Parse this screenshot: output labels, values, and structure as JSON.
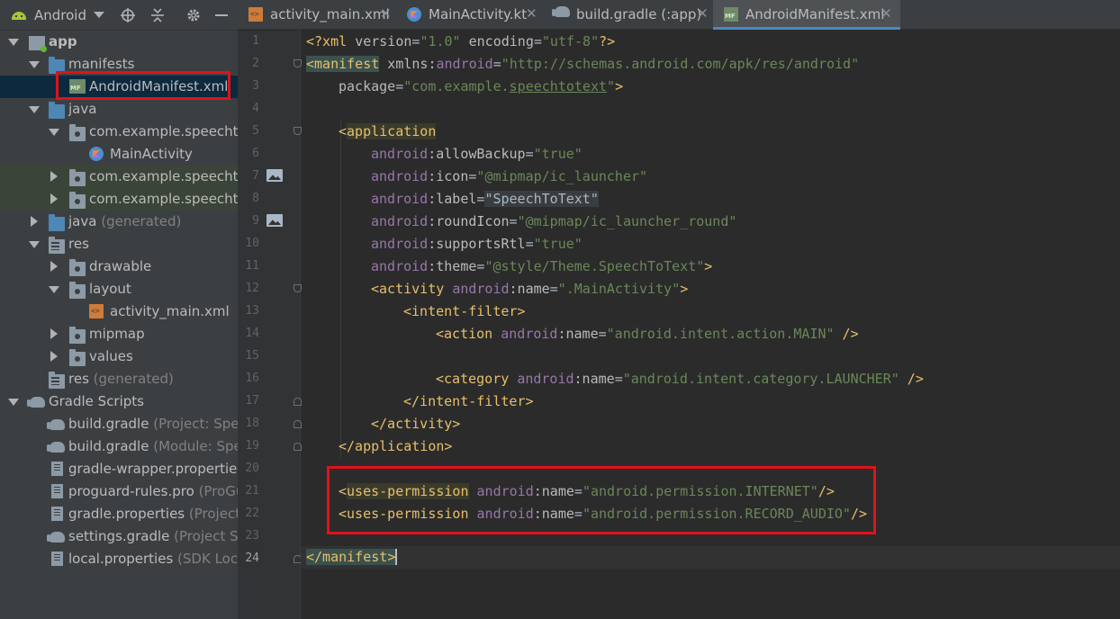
{
  "sidebar": {
    "view_label": "Android",
    "tree": [
      {
        "label": "app",
        "sub": "",
        "bold": true
      },
      {
        "label": "manifests",
        "sub": ""
      },
      {
        "label": "AndroidManifest.xml",
        "sub": ""
      },
      {
        "label": "java",
        "sub": ""
      },
      {
        "label": "com.example.speechtote",
        "sub": ""
      },
      {
        "label": "MainActivity",
        "sub": ""
      },
      {
        "label": "com.example.speechtote",
        "sub": ""
      },
      {
        "label": "com.example.speechtote",
        "sub": ""
      },
      {
        "label": "java",
        "sub": "(generated)"
      },
      {
        "label": "res",
        "sub": ""
      },
      {
        "label": "drawable",
        "sub": ""
      },
      {
        "label": "layout",
        "sub": ""
      },
      {
        "label": "activity_main.xml",
        "sub": ""
      },
      {
        "label": "mipmap",
        "sub": ""
      },
      {
        "label": "values",
        "sub": ""
      },
      {
        "label": "res",
        "sub": "(generated)"
      },
      {
        "label": "Gradle Scripts",
        "sub": ""
      },
      {
        "label": "build.gradle",
        "sub": "(Project: Speec"
      },
      {
        "label": "build.gradle",
        "sub": "(Module: Speec"
      },
      {
        "label": "gradle-wrapper.properties",
        "sub": "("
      },
      {
        "label": "proguard-rules.pro",
        "sub": "(ProGua"
      },
      {
        "label": "gradle.properties",
        "sub": "(Project P"
      },
      {
        "label": "settings.gradle",
        "sub": "(Project Sett"
      },
      {
        "label": "local.properties",
        "sub": "(SDK Locati"
      }
    ]
  },
  "tabs": [
    {
      "name": "activity_main.xml",
      "close": "✕"
    },
    {
      "name": "MainActivity.kt",
      "close": "✕"
    },
    {
      "name": "build.gradle (:app)",
      "close": "✕"
    },
    {
      "name": "AndroidManifest.xml",
      "close": "✕"
    }
  ],
  "editor": {
    "line_numbers": [
      "1",
      "2",
      "3",
      "4",
      "5",
      "6",
      "7",
      "8",
      "9",
      "10",
      "11",
      "12",
      "13",
      "14",
      "15",
      "16",
      "17",
      "18",
      "19",
      "20",
      "21",
      "22",
      "23",
      "24"
    ],
    "code": {
      "l1": {
        "a": "<?xml ",
        "b": "version",
        "c": "=",
        "d": "\"1.0\"",
        "e": " ",
        "f": "encoding",
        "g": "=",
        "h": "\"utf-8\"",
        "i": "?>"
      },
      "l2": {
        "a": "<",
        "b": "manifest",
        "c": " xmlns:",
        "d": "android",
        "e": "=",
        "f": "\"http://schemas.android.com/apk/res/android\""
      },
      "l3": {
        "a": "package",
        "b": "=",
        "c": "\"com.example.",
        "d": "speechtotext",
        "e": "\"",
        "f": ">"
      },
      "l5": {
        "a": "<",
        "b": "application"
      },
      "l6": {
        "ns": "android",
        "attr": ":allowBackup",
        "eq": "=",
        "val": "\"true\""
      },
      "l7": {
        "ns": "android",
        "attr": ":icon",
        "eq": "=",
        "val": "\"@mipmap/ic_launcher\""
      },
      "l8": {
        "ns": "android",
        "attr": ":label",
        "eq": "=",
        "val": "\"SpeechToText\""
      },
      "l9": {
        "ns": "android",
        "attr": ":roundIcon",
        "eq": "=",
        "val": "\"@mipmap/ic_launcher_round\""
      },
      "l10": {
        "ns": "android",
        "attr": ":supportsRtl",
        "eq": "=",
        "val": "\"true\""
      },
      "l11": {
        "ns": "android",
        "attr": ":theme",
        "eq": "=",
        "val": "\"@style/Theme.SpeechToText\"",
        "end": ">"
      },
      "l12": {
        "open": "<activity ",
        "ns": "android",
        "attr": ":name",
        "eq": "=",
        "val": "\".MainActivity\"",
        "end": ">"
      },
      "l13": {
        "text": "<intent-filter>"
      },
      "l14": {
        "open": "<action ",
        "ns": "android",
        "attr": ":name",
        "eq": "=",
        "val": "\"android.intent.action.MAIN\"",
        "end": " />"
      },
      "l16": {
        "open": "<category ",
        "ns": "android",
        "attr": ":name",
        "eq": "=",
        "val": "\"android.intent.category.LAUNCHER\"",
        "end": " />"
      },
      "l17": {
        "text": "</intent-filter>"
      },
      "l18": {
        "text": "</activity>"
      },
      "l19": {
        "text": "</application>"
      },
      "l21": {
        "lt": "<",
        "tag": "uses-permission",
        "sp": " ",
        "ns": "android",
        "attr": ":name",
        "eq": "=",
        "val": "\"android.permission.INTERNET\"",
        "end": "/>"
      },
      "l22": {
        "lt": "<",
        "tag": "uses-permission",
        "sp": " ",
        "ns": "android",
        "attr": ":name",
        "eq": "=",
        "val": "\"android.permission.RECORD_AUDIO\"",
        "end": "/>"
      },
      "l24": {
        "a": "</manifest",
        "b": ">"
      }
    }
  },
  "colors": {
    "highlight_box": "#e0121a",
    "selection": "#0d293e",
    "active_tab_underline": "#4a88c7"
  }
}
